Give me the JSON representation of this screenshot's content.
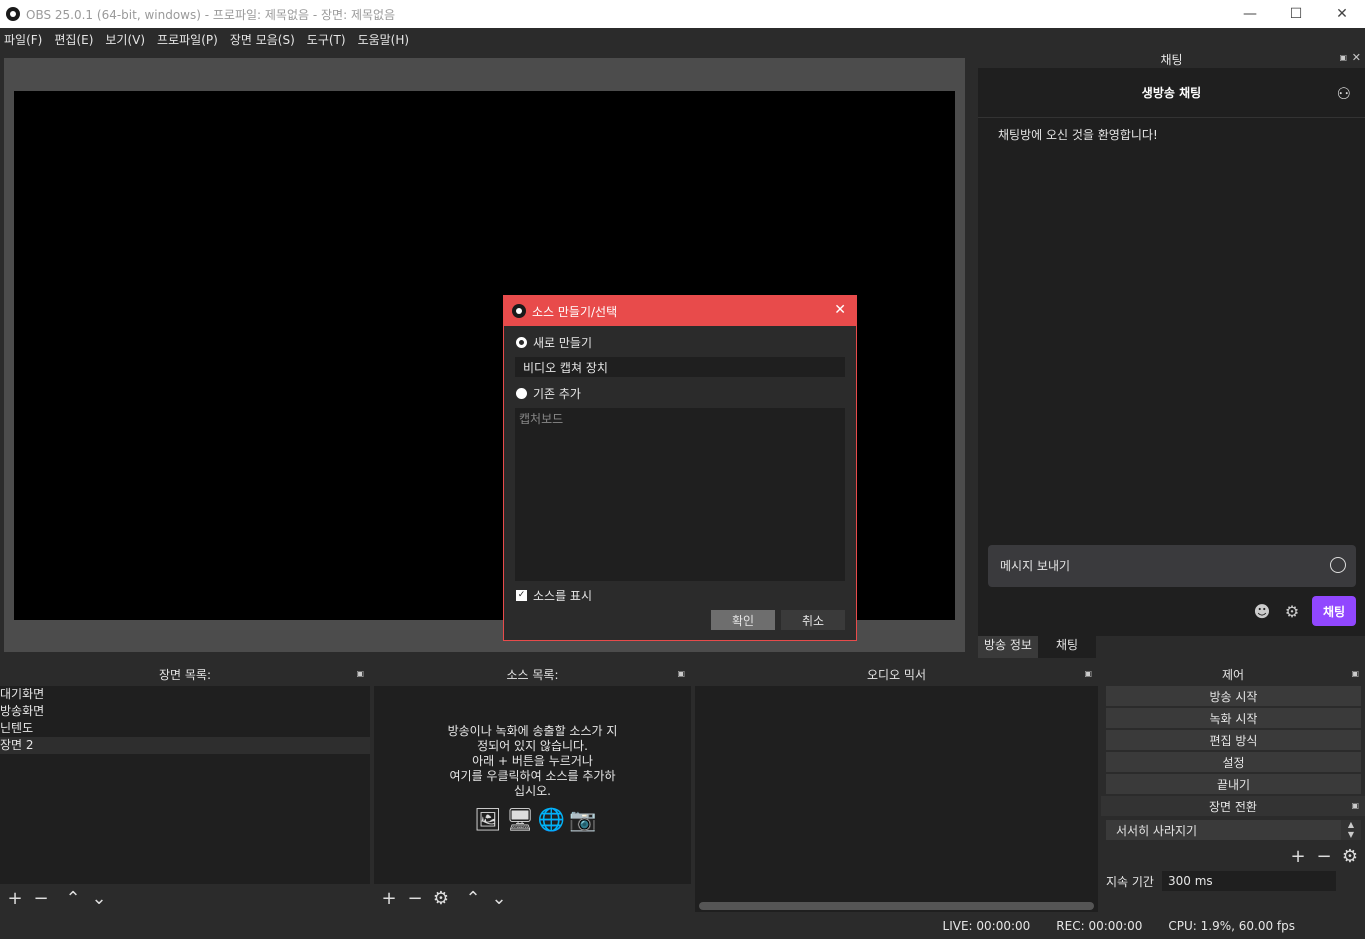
{
  "window": {
    "title": "OBS 25.0.1 (64-bit, windows) - 프로파일: 제목없음 - 장면: 제목없음"
  },
  "menu": [
    "파일(F)",
    "편집(E)",
    "보기(V)",
    "프로파일(P)",
    "장면 모음(S)",
    "도구(T)",
    "도움말(H)"
  ],
  "chat": {
    "dock_title": "채팅",
    "header": "생방송 채팅",
    "welcome": "채팅방에 오신 것을 환영합니다!",
    "input_placeholder": "메시지 보내기",
    "send_label": "채팅",
    "send_color": "#9147ff"
  },
  "dock_tabs": [
    "방송 정보",
    "채팅"
  ],
  "scenes": {
    "title": "장면 목록:",
    "items": [
      "대기화면",
      "방송화면",
      "닌텐도",
      "장면 2"
    ],
    "selected": 3
  },
  "sources": {
    "title": "소스 목록:",
    "empty_lines": [
      "방송이나 녹화에 송출할 소스가 지",
      "정되어 있지 않습니다.",
      "아래 + 버튼을 누르거나",
      "여기를 우클릭하여 소스를 추가하",
      "십시오."
    ]
  },
  "mixer": {
    "title": "오디오 믹서"
  },
  "controls": {
    "title": "제어",
    "buttons": [
      "방송 시작",
      "녹화 시작",
      "편집 방식",
      "설정",
      "끝내기"
    ]
  },
  "transitions": {
    "title": "장면 전환",
    "selected": "서서히 사라지기",
    "duration_label": "지속 기간",
    "duration_value": "300 ms"
  },
  "status": {
    "live": "LIVE: 00:00:00",
    "rec": "REC: 00:00:00",
    "cpu": "CPU: 1.9%, 60.00 fps"
  },
  "dialog": {
    "title": "소스 만들기/선택",
    "accent": "#e84b4b",
    "new_label": "새로 만들기",
    "new_value": "비디오 캡쳐 장치",
    "existing_label": "기존 추가",
    "existing_items": [
      "캡처보드"
    ],
    "show_label": "소스를 표시",
    "ok_label": "확인",
    "cancel_label": "취소"
  }
}
